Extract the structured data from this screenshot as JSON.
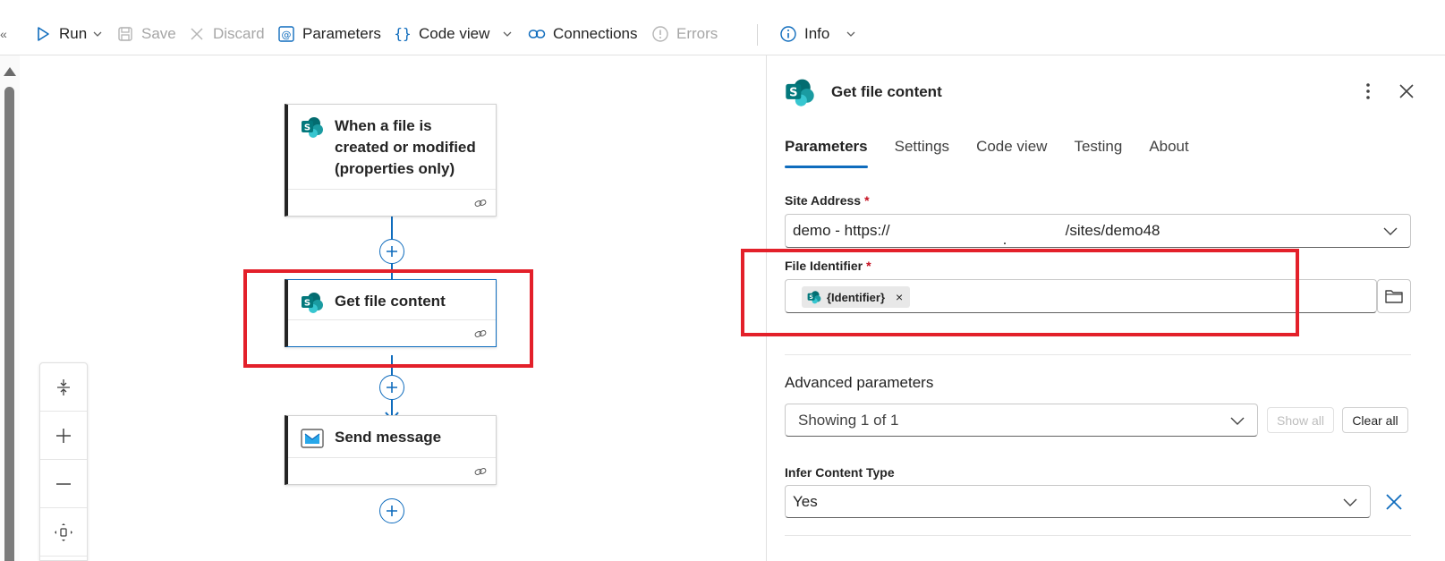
{
  "toolbar": {
    "collapse_glyph": "«",
    "run": "Run",
    "save": "Save",
    "discard": "Discard",
    "parameters": "Parameters",
    "code_view": "Code view",
    "connections": "Connections",
    "errors": "Errors",
    "info": "Info"
  },
  "flow": {
    "trigger": {
      "title": "When a file is created or modified (properties only)",
      "icon": "sharepoint-icon"
    },
    "action1": {
      "title": "Get file content",
      "icon": "sharepoint-icon"
    },
    "action2": {
      "title": "Send message",
      "icon": "outlook-mail-icon"
    }
  },
  "panel": {
    "title": "Get file content",
    "tabs": [
      "Parameters",
      "Settings",
      "Code view",
      "Testing",
      "About"
    ],
    "active_tab": "Parameters",
    "site_address": {
      "label": "Site Address",
      "required_mark": "*",
      "value_prefix": "demo - https://",
      "value_dot": ".",
      "value_suffix": "/sites/demo48"
    },
    "file_identifier": {
      "label": "File Identifier",
      "required_mark": "*",
      "token": "{Identifier}",
      "token_remove": "×"
    },
    "advanced": {
      "label": "Advanced parameters",
      "dropdown_value": "Showing 1 of 1",
      "show_all": "Show all",
      "clear_all": "Clear all"
    },
    "infer_content_type": {
      "label": "Infer Content Type",
      "value": "Yes"
    }
  },
  "colors": {
    "accent": "#0f6cbd",
    "highlight": "#e3202a",
    "sharepoint": "#038387"
  }
}
